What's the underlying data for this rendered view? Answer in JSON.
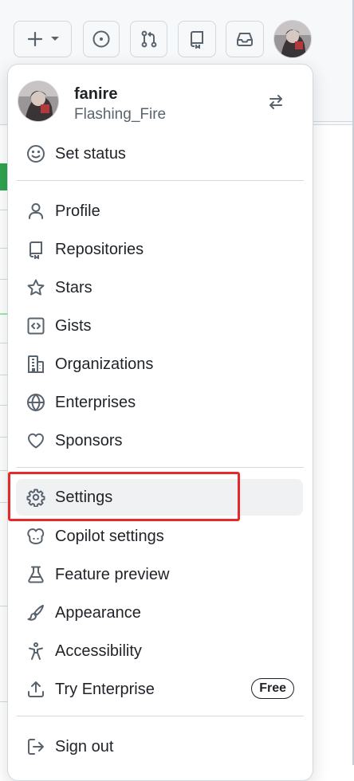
{
  "user": {
    "login": "fanire",
    "name": "Flashing_Fire"
  },
  "menu": {
    "set_status": "Set status",
    "group1": [
      {
        "label": "Profile",
        "icon": "person-icon"
      },
      {
        "label": "Repositories",
        "icon": "repo-icon"
      },
      {
        "label": "Stars",
        "icon": "star-icon"
      },
      {
        "label": "Gists",
        "icon": "code-square-icon"
      },
      {
        "label": "Organizations",
        "icon": "organization-icon"
      },
      {
        "label": "Enterprises",
        "icon": "globe-icon"
      },
      {
        "label": "Sponsors",
        "icon": "heart-icon"
      }
    ],
    "group2": [
      {
        "label": "Settings",
        "icon": "gear-icon"
      },
      {
        "label": "Copilot settings",
        "icon": "copilot-icon"
      },
      {
        "label": "Feature preview",
        "icon": "beaker-icon"
      },
      {
        "label": "Appearance",
        "icon": "paintbrush-icon"
      },
      {
        "label": "Accessibility",
        "icon": "accessibility-icon"
      },
      {
        "label": "Try Enterprise",
        "icon": "upload-icon",
        "badge": "Free"
      }
    ],
    "sign_out": "Sign out"
  },
  "colors": {
    "highlight": "#e8292a",
    "active_item": "#f0f1f3"
  }
}
